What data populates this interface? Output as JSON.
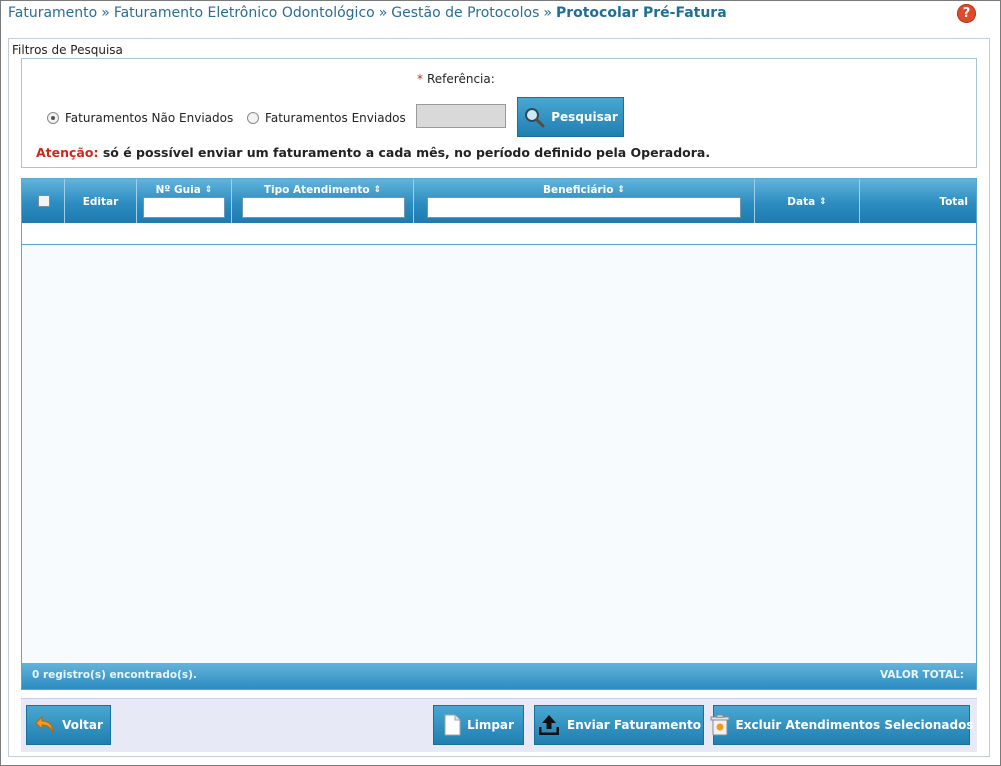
{
  "breadcrumb": {
    "items": [
      "Faturamento",
      "Faturamento Eletrônico Odontológico",
      "Gestão de Protocolos"
    ],
    "separator": "»",
    "current": "Protocolar Pré-Fatura"
  },
  "help_icon_symbol": "?",
  "filters": {
    "title": "Filtros de Pesquisa",
    "reference_required_mark": "*",
    "reference_label": "Referência:",
    "reference_value": "",
    "radio_not_sent": "Faturamentos Não Enviados",
    "radio_sent": "Faturamentos Enviados",
    "selected_radio": "not_sent",
    "search_button": "Pesquisar",
    "attention_label": "Atenção:",
    "attention_text": "só é possível enviar um faturamento a cada mês, no período definido pela Operadora."
  },
  "table": {
    "columns": [
      {
        "label": "",
        "type": "checkbox"
      },
      {
        "label": "Editar",
        "sortable": false
      },
      {
        "label": "Nº Guia",
        "sortable": true,
        "filter": true
      },
      {
        "label": "Tipo Atendimento",
        "sortable": true,
        "filter": true
      },
      {
        "label": "Beneficiário",
        "sortable": true,
        "filter": true
      },
      {
        "label": "Data",
        "sortable": true
      },
      {
        "label": "Total",
        "sortable": false
      }
    ],
    "rows": [],
    "footer_count": "0 registro(s) encontrado(s).",
    "footer_total_label": "VALOR TOTAL:"
  },
  "actions": {
    "back": "Voltar",
    "clear": "Limpar",
    "send": "Enviar Faturamento",
    "delete": "Excluir Atendimentos Selecionados"
  },
  "colors": {
    "header_blue": "#2c8cc0",
    "link_blue": "#2a6d94",
    "warning_red": "#d1261a",
    "help_red": "#e0492a"
  }
}
